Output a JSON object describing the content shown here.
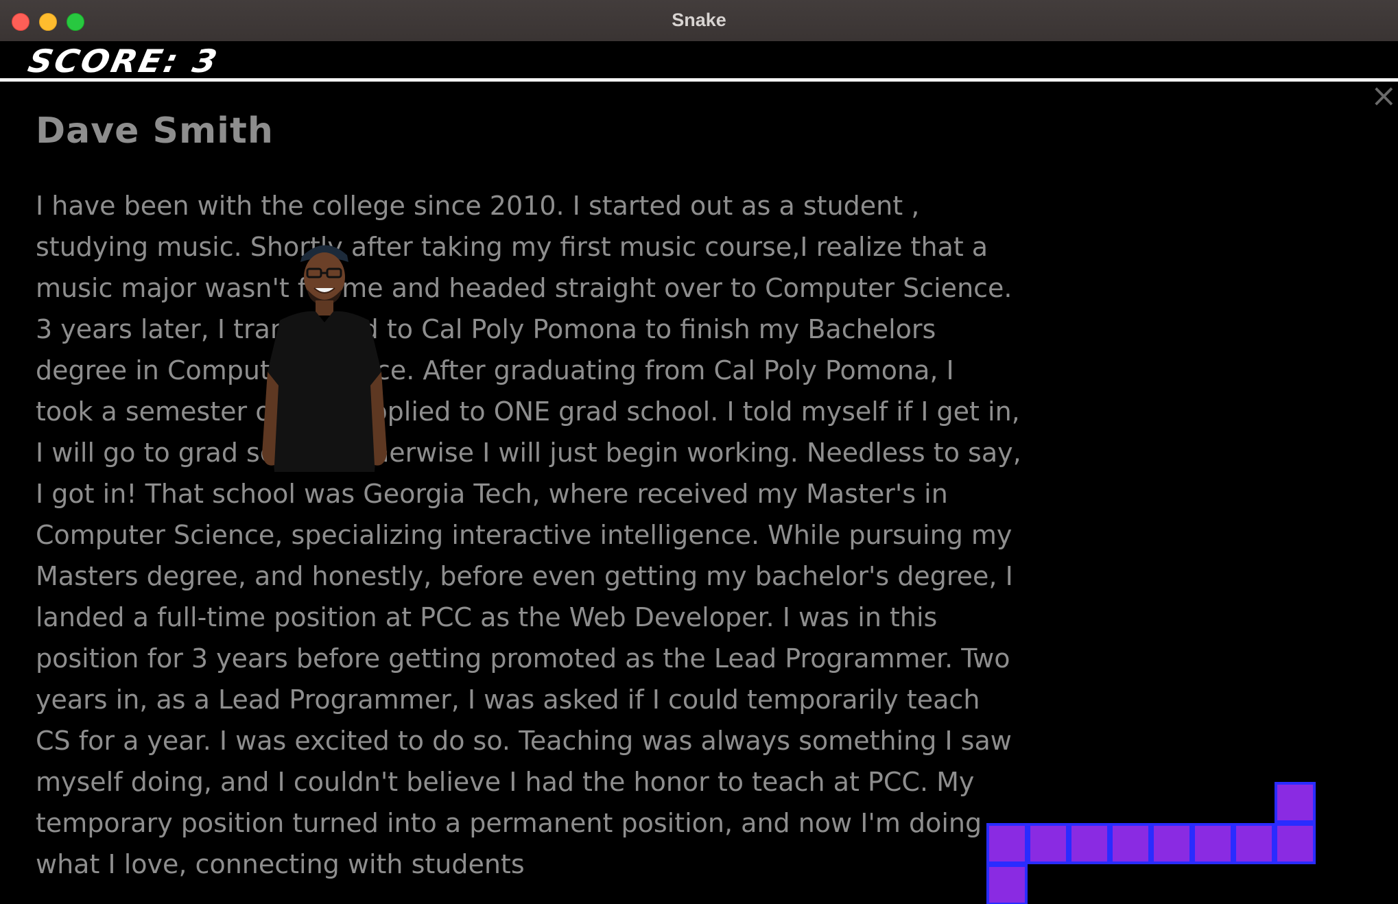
{
  "window": {
    "title": "Snake"
  },
  "hud": {
    "score_text": "SCORE: 3"
  },
  "overlay": {
    "close_glyph": "×",
    "name": "Dave Smith",
    "bio_lines": [
      "I have been with the college since 2010. I started out as a student ,",
      "studying music. Shortly after taking my first music course,I realize that a",
      "music major wasn't for me and headed straight over to Computer Science.",
      "3 years later, I transferred to Cal Poly Pomona to finish my Bachelors",
      "degree in Computer Science. After graduating from Cal Poly Pomona, I",
      "took a semester off and applied to ONE grad school. I told myself if I get in,",
      "I will go to grad school, otherwise I will just begin working. Needless to say,",
      "I got in! That school was Georgia Tech, where received my Master's in",
      "Computer Science, specializing interactive intelligence. While pursuing my",
      "Masters degree, and honestly, before even getting my bachelor's degree, I",
      "landed a full-time position at PCC as the Web Developer. I was in this",
      "position for 3 years before getting promoted as the Lead Programmer. Two",
      "years in, as a Lead Programmer, I was asked if I could temporarily teach",
      "CS for a year. I was excited to do so. Teaching was always something I saw",
      "myself doing, and I couldn't believe I had the honor to teach at PCC. My",
      "temporary position turned into a permanent position, and now I'm doing",
      "what I love, connecting with students"
    ]
  },
  "snake": {
    "fill_color": "#8a2be2",
    "border_color": "#2a2cff",
    "cells": [
      {
        "col": 31,
        "row": 19
      },
      {
        "col": 31,
        "row": 20
      },
      {
        "col": 30,
        "row": 20
      },
      {
        "col": 29,
        "row": 20
      },
      {
        "col": 28,
        "row": 20
      },
      {
        "col": 27,
        "row": 20
      },
      {
        "col": 26,
        "row": 20
      },
      {
        "col": 25,
        "row": 20
      },
      {
        "col": 24,
        "row": 20
      },
      {
        "col": 24,
        "row": 21
      }
    ]
  }
}
